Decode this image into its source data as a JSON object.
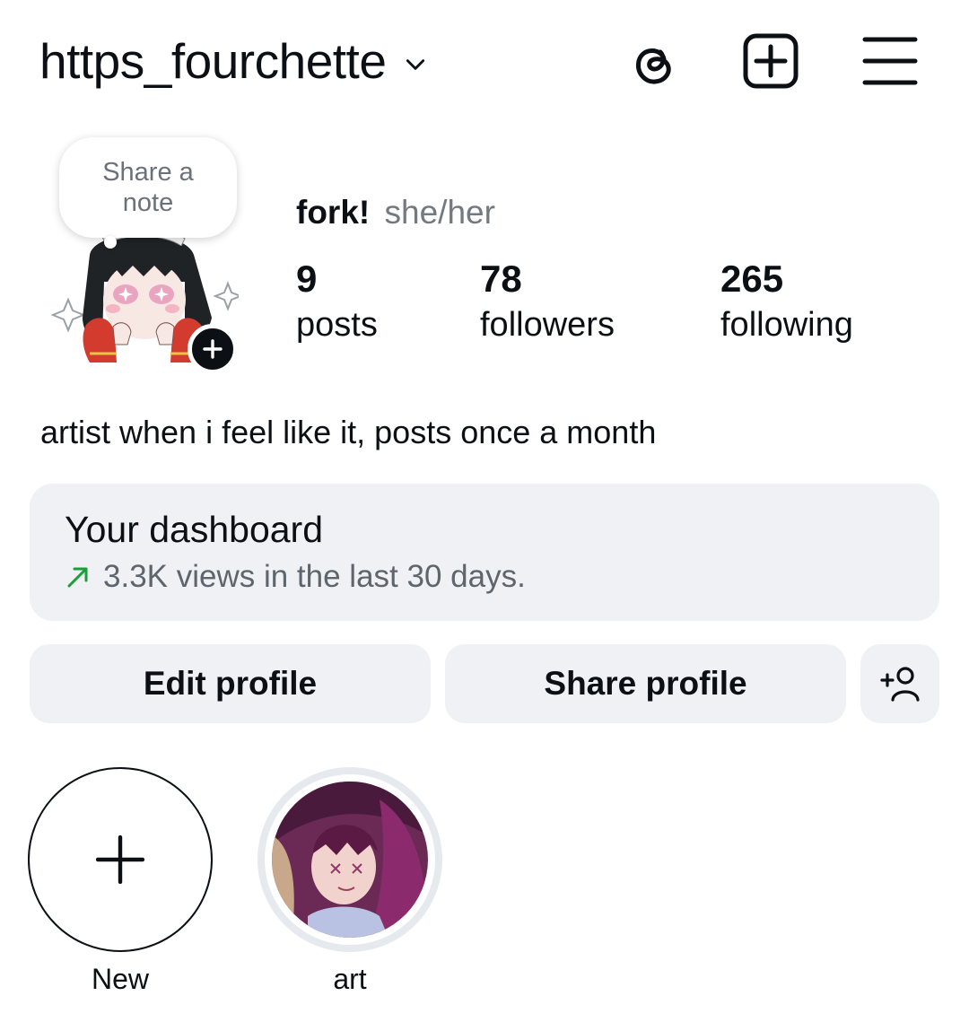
{
  "header": {
    "username": "https_fourchette",
    "icons": [
      "threads-icon",
      "create-icon",
      "menu-icon"
    ]
  },
  "profile": {
    "note_placeholder": "Share a note",
    "display_name": "fork!",
    "pronouns": "she/her",
    "stats": {
      "posts": {
        "value": "9",
        "label": "posts"
      },
      "followers": {
        "value": "78",
        "label": "followers"
      },
      "following": {
        "value": "265",
        "label": "following"
      }
    },
    "bio": "artist when i feel like it, posts once a month"
  },
  "dashboard": {
    "title": "Your dashboard",
    "subtitle": "3.3K views in the last 30 days.",
    "trend_color": "#1a9e3a"
  },
  "actions": {
    "edit_label": "Edit profile",
    "share_label": "Share profile"
  },
  "highlights": [
    {
      "label": "New"
    },
    {
      "label": "art"
    }
  ]
}
